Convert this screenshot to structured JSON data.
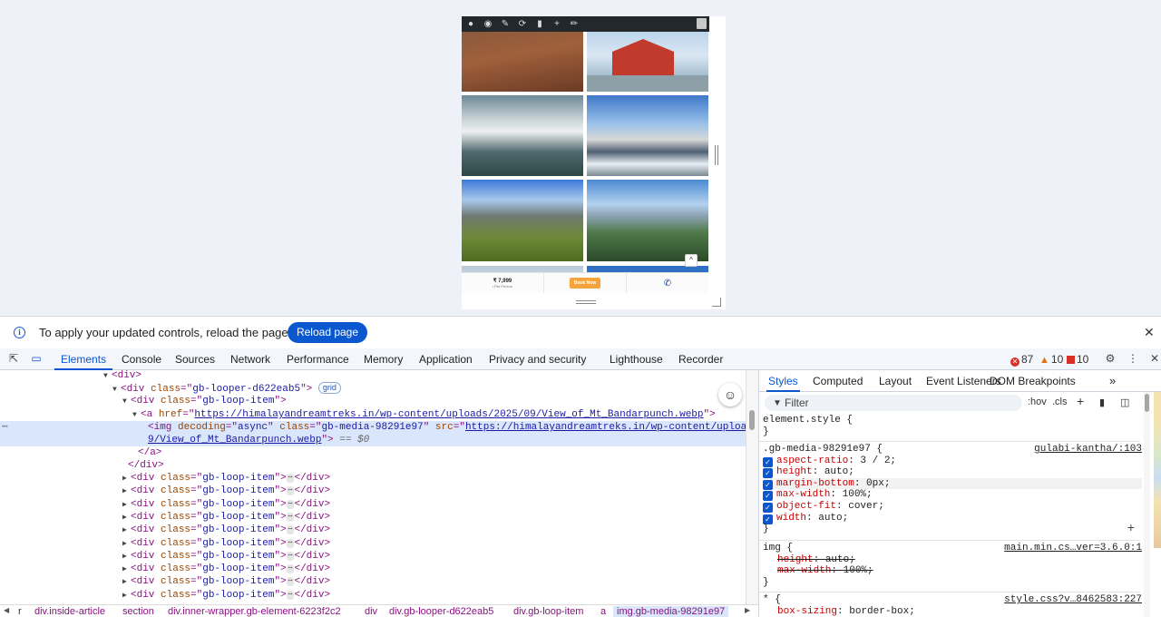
{
  "preview": {
    "price": "₹ 7,999",
    "price_note": "/ Per Person",
    "book_label": "Book Now",
    "scroll_top_icon": "chevron-up-icon"
  },
  "notice": {
    "text": "To apply your updated controls, reload the page",
    "button": "Reload page"
  },
  "devtools": {
    "tabs": [
      "Elements",
      "Console",
      "Sources",
      "Network",
      "Performance",
      "Memory",
      "Application",
      "Privacy and security",
      "Lighthouse",
      "Recorder"
    ],
    "active_tab": "Elements",
    "errors": "87",
    "warnings": "10",
    "issues": "10"
  },
  "dom": {
    "lines": [
      {
        "t": "close_div_open",
        "text": "<div>"
      },
      {
        "tag": "div",
        "attr": "class",
        "val": "gb-looper-d622eab5",
        "badge": "grid"
      },
      {
        "tag": "div",
        "attr": "class",
        "val": "gb-loop-item"
      },
      {
        "tag": "a",
        "attr": "href",
        "val": "https://himalayandreamtreks.in/wp-content/uploads/2025/09/View_of_Mt_Bandarpunch.webp"
      },
      {
        "tag": "img",
        "attr1": "decoding",
        "val1": "async",
        "attr2": "class",
        "val2": "gb-media-98291e97",
        "attr3": "src",
        "val3a": "https://himalayandreamtreks.in/wp-content/uploads/2025/0",
        "val3b": "9/View_of_Mt_Bandarpunch.webp",
        "eq": "== $0"
      },
      {
        "close": "</a>"
      },
      {
        "close": "</div>"
      },
      {
        "repeat_class": "gb-loop-item",
        "count": 10
      }
    ]
  },
  "breadcrumbs": [
    "r",
    "div.inside-article",
    "section",
    "div.inner-wrapper.gb-element-6223f2c2",
    "div",
    "div.gb-looper-d622eab5",
    "div.gb-loop-item",
    "a",
    "img.gb-media-98291e97"
  ],
  "styles": {
    "tabs": [
      "Styles",
      "Computed",
      "Layout",
      "Event Listeners",
      "DOM Breakpoints"
    ],
    "filter_placeholder": "Filter",
    "hov": ":hov",
    "cls": ".cls",
    "element_style": "element.style {",
    "close_brace": "}",
    "rule1": {
      "selector": ".gb-media-98291e97 {",
      "source": "gulabi-kantha/:103",
      "props": [
        {
          "name": "aspect-ratio",
          "value": "3 / 2;"
        },
        {
          "name": "height",
          "value": "auto;"
        },
        {
          "name": "margin-bottom",
          "value": "0px;"
        },
        {
          "name": "max-width",
          "value": "100%;"
        },
        {
          "name": "object-fit",
          "value": "cover;"
        },
        {
          "name": "width",
          "value": "auto;"
        }
      ]
    },
    "rule2": {
      "selector": "img {",
      "source": "main.min.cs…ver=3.6.0:1",
      "props": [
        {
          "name": "height",
          "value": "auto;"
        },
        {
          "name": "max-width",
          "value": "100%;"
        }
      ]
    },
    "rule3": {
      "selector": "* {",
      "source": "style.css?v…8462583:227",
      "props": [
        {
          "name": "box-sizing",
          "value": "border-box;"
        }
      ]
    }
  }
}
